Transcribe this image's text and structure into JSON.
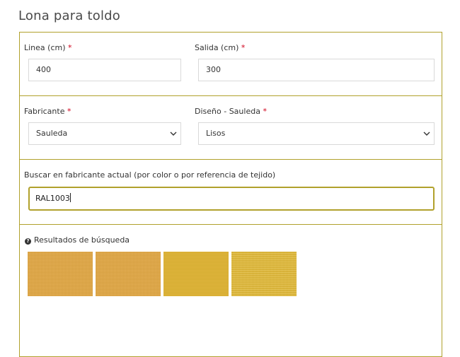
{
  "page": {
    "title": "Lona para toldo"
  },
  "linea": {
    "label": "Linea (cm)",
    "required_mark": "*",
    "value": "400"
  },
  "salida": {
    "label": "Salida (cm)",
    "required_mark": "*",
    "value": "300"
  },
  "fabricante": {
    "label": "Fabricante",
    "required_mark": "*",
    "selected": "Sauleda"
  },
  "diseno": {
    "label": "Diseño - Sauleda",
    "required_mark": "*",
    "selected": "Lisos"
  },
  "search": {
    "label": "Buscar en fabricante actual (por color o por referencia de tejido)",
    "value": "RAL1003"
  },
  "results": {
    "help_icon": "?",
    "label": "Resultados de búsqueda",
    "swatches": [
      {
        "name": "swatch-1",
        "color": "#e2a640"
      },
      {
        "name": "swatch-2",
        "color": "#e2a640"
      },
      {
        "name": "swatch-3",
        "color": "#ddb234"
      },
      {
        "name": "swatch-4",
        "color": "#e2bb3c"
      }
    ]
  },
  "theme": {
    "accent": "#b1a12c",
    "required": "#d0021b"
  }
}
